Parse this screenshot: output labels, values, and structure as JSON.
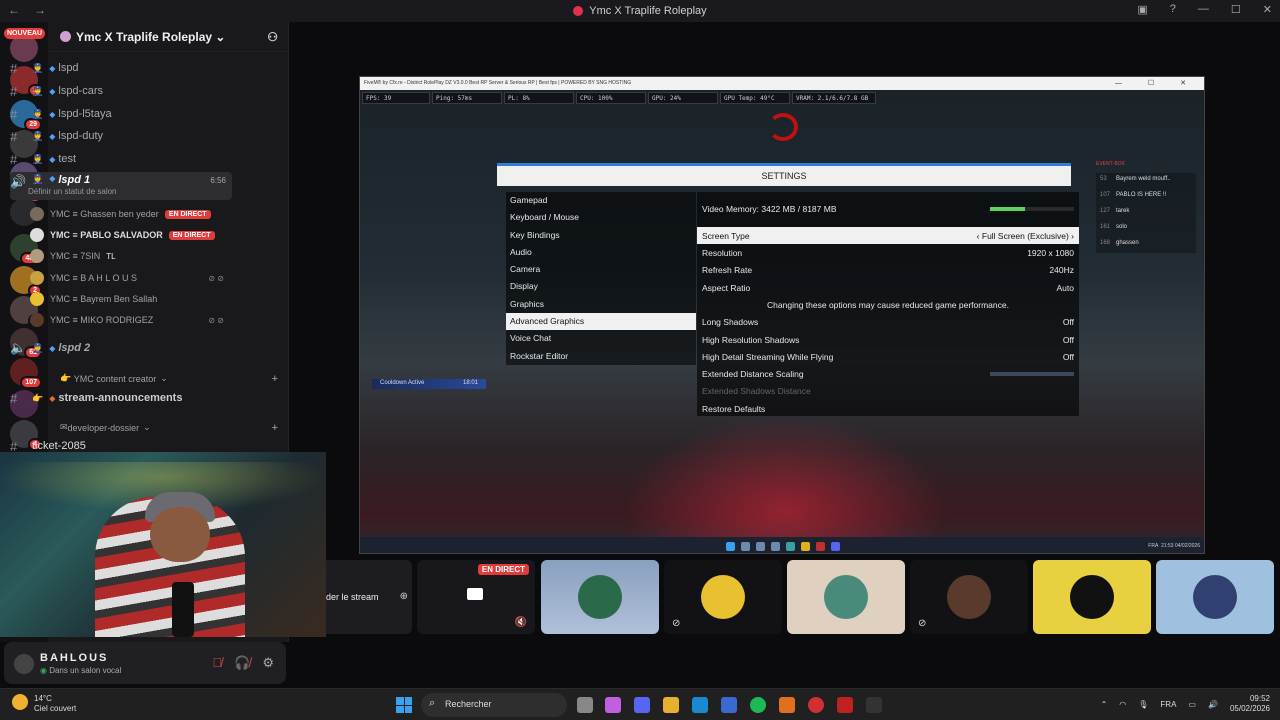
{
  "window": {
    "title": "Ymc X Traplife Roleplay"
  },
  "server": {
    "name": "Ymc X Traplife Roleplay",
    "nouveau": "NOUVEAU"
  },
  "rail_badges": [
    "1",
    "29",
    "1",
    "489",
    "2",
    "1",
    "62",
    "107",
    "4"
  ],
  "channels": [
    {
      "name": "lspd"
    },
    {
      "name": "lspd-cars"
    },
    {
      "name": "lspd-l5taya"
    },
    {
      "name": "lspd-duty"
    },
    {
      "name": "test"
    }
  ],
  "voice_active": {
    "name": "lspd 1",
    "timer": "6:56",
    "status": "Définir un statut de salon"
  },
  "voice_users": [
    {
      "name": "YMC ≡ Ghassen ben yeder",
      "live": "EN DIRECT"
    },
    {
      "name": "YMC ≡ PABLO SALVADOR",
      "live": "EN DIRECT"
    },
    {
      "name": "YMC ≡ 7SIN",
      "live": "",
      "extra": "TL"
    },
    {
      "name": "YMC ≡ B A H L O U S",
      "live": ""
    },
    {
      "name": "YMC ≡ Bayrem Ben Sallah",
      "live": ""
    },
    {
      "name": "YMC ≡ MIKO RODRIGEZ",
      "live": ""
    }
  ],
  "voice2": {
    "name": "lspd 2"
  },
  "category1": {
    "name": "YMC content creator"
  },
  "channel_stream": {
    "name": "stream-announcements"
  },
  "category2": {
    "name": "developer-dossier"
  },
  "channel_ticket": {
    "name": "ticket-2085"
  },
  "user": {
    "name": "BAHLOUS",
    "status": "Dans un salon vocal"
  },
  "game": {
    "titlebar": "FiveM® by Cfx.re - District RolePlay DZ V3.0.0 Best RP Server & Serious RP | Best fps | POWERED BY SNG HOSTING",
    "perf": [
      "FPS: 39",
      "Ping: 57ms",
      "PL: 8%",
      "CPU: 100%",
      "GPU: 24%",
      "GPU Temp: 49°C",
      "VRAM: 2.1/6.6/7.8 GB"
    ],
    "settings_title": "SETTINGS",
    "menu": [
      "Gamepad",
      "Keyboard / Mouse",
      "Key Bindings",
      "Audio",
      "Camera",
      "Display",
      "Graphics",
      "Advanced Graphics",
      "Voice Chat",
      "Rockstar Editor"
    ],
    "menu_selected_index": 7,
    "video_memory": "Video Memory: 3422 MB / 8187 MB",
    "video_memory_fraction": 0.42,
    "screen_type": {
      "label": "Screen Type",
      "value": "Full Screen (Exclusive)"
    },
    "resolution": {
      "label": "Resolution",
      "value": "1920 x 1080"
    },
    "refresh": {
      "label": "Refresh Rate",
      "value": "240Hz"
    },
    "aspect": {
      "label": "Aspect Ratio",
      "value": "Auto"
    },
    "warning": "Changing these options may cause reduced game performance.",
    "long_shadows": {
      "label": "Long Shadows",
      "value": "Off"
    },
    "hr_shadows": {
      "label": "High Resolution Shadows",
      "value": "Off"
    },
    "hd_stream": {
      "label": "High Detail Streaming While Flying",
      "value": "Off"
    },
    "ext_dist": {
      "label": "Extended Distance Scaling"
    },
    "ext_shadow": {
      "label": "Extended Shadows Distance"
    },
    "restore": "Restore Defaults",
    "cooldown": {
      "label": "Cooldown Active",
      "value": "18:01"
    },
    "players": [
      {
        "id": "53",
        "name": "Bayrem weld mouff.."
      },
      {
        "id": "107",
        "name": "PABLO IS HERE !!"
      },
      {
        "id": "127",
        "name": "tarek"
      },
      {
        "id": "161",
        "name": "solo"
      },
      {
        "id": "168",
        "name": "ghassen"
      }
    ],
    "players_header": "EVENT·BOX",
    "taskbar_time": "21:53",
    "taskbar_date": "04/02/2026",
    "taskbar_lang": "FRA"
  },
  "stream_bar": {
    "leave": "der le stream",
    "live": "EN DIRECT"
  },
  "taskbar": {
    "temp": "14°C",
    "weather": "Ciel couvert",
    "search": "Rechercher",
    "lang": "FRA",
    "time": "09:52",
    "date": "05/02/2026"
  },
  "colors": {
    "accent": "#e23b3b",
    "link": "#4aa3ff",
    "green": "#3ba55c"
  }
}
